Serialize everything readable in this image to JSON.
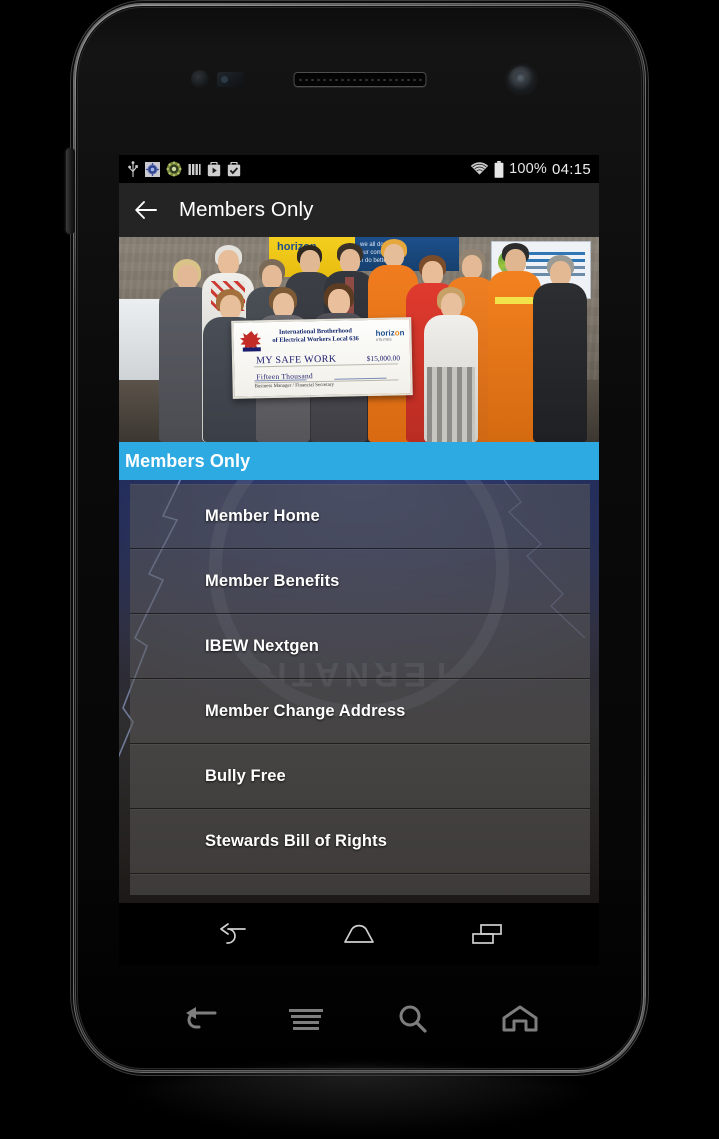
{
  "status_bar": {
    "icons": [
      "usb-icon",
      "sync-circle-icon",
      "gear-flower-icon",
      "signal-bars-icon",
      "play-store-icon",
      "app-install-icon"
    ],
    "wifi_icon": "wifi-icon",
    "battery_icon": "battery-full-icon",
    "battery_text": "100%",
    "clock": "04:15"
  },
  "app_bar": {
    "back_icon": "back-arrow-icon",
    "title": "Members Only"
  },
  "hero": {
    "alt": "group-photo-cheque-presentation",
    "cheque": {
      "org_line1": "International Brotherhood",
      "org_line2": "of Electrical Workers Local 636",
      "sponsor": "horiz",
      "sponsor_accent": "o",
      "sponsor_tail": "n",
      "sponsor_sub": "UTILITIES",
      "pay_to": "MY SAFE WORK",
      "amount": "$15,000.00",
      "amount_words": "Fifteen Thousand",
      "signature_label": "Business Manager / Financial Secretary"
    },
    "right_poster": "canadian-electricity-association-poster",
    "left_banner": "horizon-utilities-banner"
  },
  "section_header": {
    "label": "Members Only",
    "color": "#2DAAE1"
  },
  "menu": {
    "items": [
      {
        "label": "Member Home"
      },
      {
        "label": "Member Benefits"
      },
      {
        "label": "IBEW Nextgen"
      },
      {
        "label": "Member Change Address"
      },
      {
        "label": "Bully Free"
      },
      {
        "label": "Stewards Bill of Rights"
      }
    ],
    "partial_item_label": ""
  },
  "nav_bar": {
    "back": "nav-back-icon",
    "home": "nav-home-icon",
    "recents": "nav-recents-icon"
  },
  "capacitive_keys": {
    "back": "cap-back-icon",
    "menu": "cap-menu-icon",
    "search": "cap-search-icon",
    "home": "cap-home-icon"
  },
  "device": {
    "earpiece": "earpiece-speaker",
    "front_camera": "front-camera",
    "proximity_sensor": "proximity-sensor",
    "volume_rocker": "volume-rocker-button"
  },
  "colors": {
    "accent_blue": "#2DAAE1",
    "app_bar": "#242424",
    "list_item": "rgba(92,90,88,0.52)",
    "status_bar": "#000000"
  }
}
